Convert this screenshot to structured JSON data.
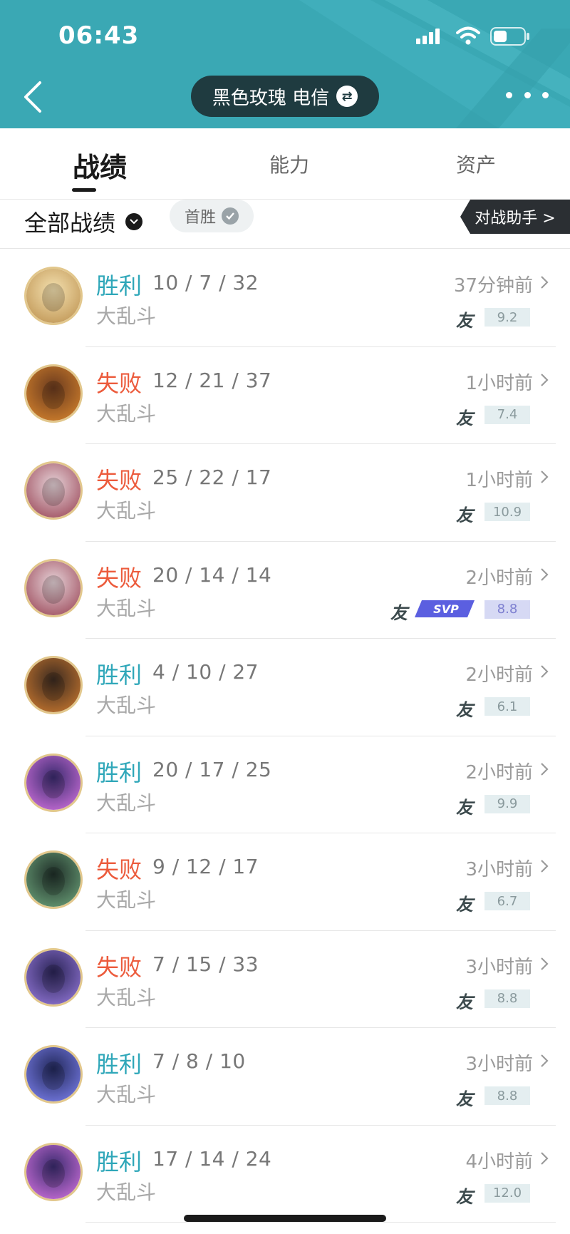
{
  "status_bar": {
    "time": "06:43"
  },
  "header": {
    "title": "黑色玫瑰 电信",
    "colors": {
      "background": "#3aa8b4",
      "pill": "#1f3b40"
    }
  },
  "tabs": [
    {
      "label": "战绩",
      "active": true
    },
    {
      "label": "能力",
      "active": false
    },
    {
      "label": "资产",
      "active": false
    }
  ],
  "filter": {
    "all_records": "全部战绩",
    "first_win": "首胜",
    "assistant": "对战助手 >"
  },
  "matches": [
    {
      "result": "胜利",
      "outcome": "win",
      "kda": "10 / 7 / 32",
      "mode": "大乱斗",
      "time": "37分钟前",
      "friend": "友",
      "score": "9.2",
      "svp": false
    },
    {
      "result": "失败",
      "outcome": "loss",
      "kda": "12 / 21 / 37",
      "mode": "大乱斗",
      "time": "1小时前",
      "friend": "友",
      "score": "7.4",
      "svp": false
    },
    {
      "result": "失败",
      "outcome": "loss",
      "kda": "25 / 22 / 17",
      "mode": "大乱斗",
      "time": "1小时前",
      "friend": "友",
      "score": "10.9",
      "svp": false
    },
    {
      "result": "失败",
      "outcome": "loss",
      "kda": "20 / 14 / 14",
      "mode": "大乱斗",
      "time": "2小时前",
      "friend": "友",
      "score": "8.8",
      "svp": true,
      "svp_label": "SVP"
    },
    {
      "result": "胜利",
      "outcome": "win",
      "kda": "4 / 10 / 27",
      "mode": "大乱斗",
      "time": "2小时前",
      "friend": "友",
      "score": "6.1",
      "svp": false
    },
    {
      "result": "胜利",
      "outcome": "win",
      "kda": "20 / 17 / 25",
      "mode": "大乱斗",
      "time": "2小时前",
      "friend": "友",
      "score": "9.9",
      "svp": false
    },
    {
      "result": "失败",
      "outcome": "loss",
      "kda": "9 / 12 / 17",
      "mode": "大乱斗",
      "time": "3小时前",
      "friend": "友",
      "score": "6.7",
      "svp": false
    },
    {
      "result": "失败",
      "outcome": "loss",
      "kda": "7 / 15 / 33",
      "mode": "大乱斗",
      "time": "3小时前",
      "friend": "友",
      "score": "8.8",
      "svp": false
    },
    {
      "result": "胜利",
      "outcome": "win",
      "kda": "7 / 8 / 10",
      "mode": "大乱斗",
      "time": "3小时前",
      "friend": "友",
      "score": "8.8",
      "svp": false
    },
    {
      "result": "胜利",
      "outcome": "win",
      "kda": "17 / 14 / 24",
      "mode": "大乱斗",
      "time": "4小时前",
      "friend": "友",
      "score": "12.0",
      "svp": false
    }
  ],
  "colors": {
    "win": "#2fa7b9",
    "loss": "#ec5b3c"
  }
}
